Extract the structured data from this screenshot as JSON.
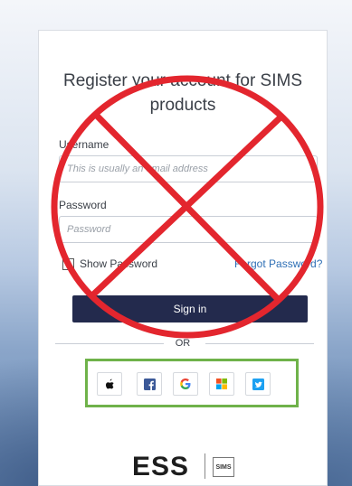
{
  "form": {
    "title": "Register your account for SIMS products",
    "username_label": "Username",
    "username_placeholder": "This is usually an email address",
    "password_label": "Password",
    "password_placeholder": "Password",
    "show_password_label": "Show Password",
    "forgot_password_label": "Forgot Password?",
    "sign_in_label": "Sign in",
    "or_label": "OR"
  },
  "social": [
    {
      "name": "apple-icon",
      "label": "Apple"
    },
    {
      "name": "facebook-icon",
      "label": "Facebook"
    },
    {
      "name": "google-icon",
      "label": "Google"
    },
    {
      "name": "microsoft-icon",
      "label": "Microsoft"
    },
    {
      "name": "twitter-icon",
      "label": "Twitter"
    }
  ],
  "branding": {
    "ess_logo": "ESS",
    "sims_badge": "SIMS"
  },
  "colors": {
    "sign_in_bg": "#232a4d",
    "link": "#2f6fb5",
    "overlay_x": "#e3262e",
    "social_highlight": "#6fb24a"
  }
}
